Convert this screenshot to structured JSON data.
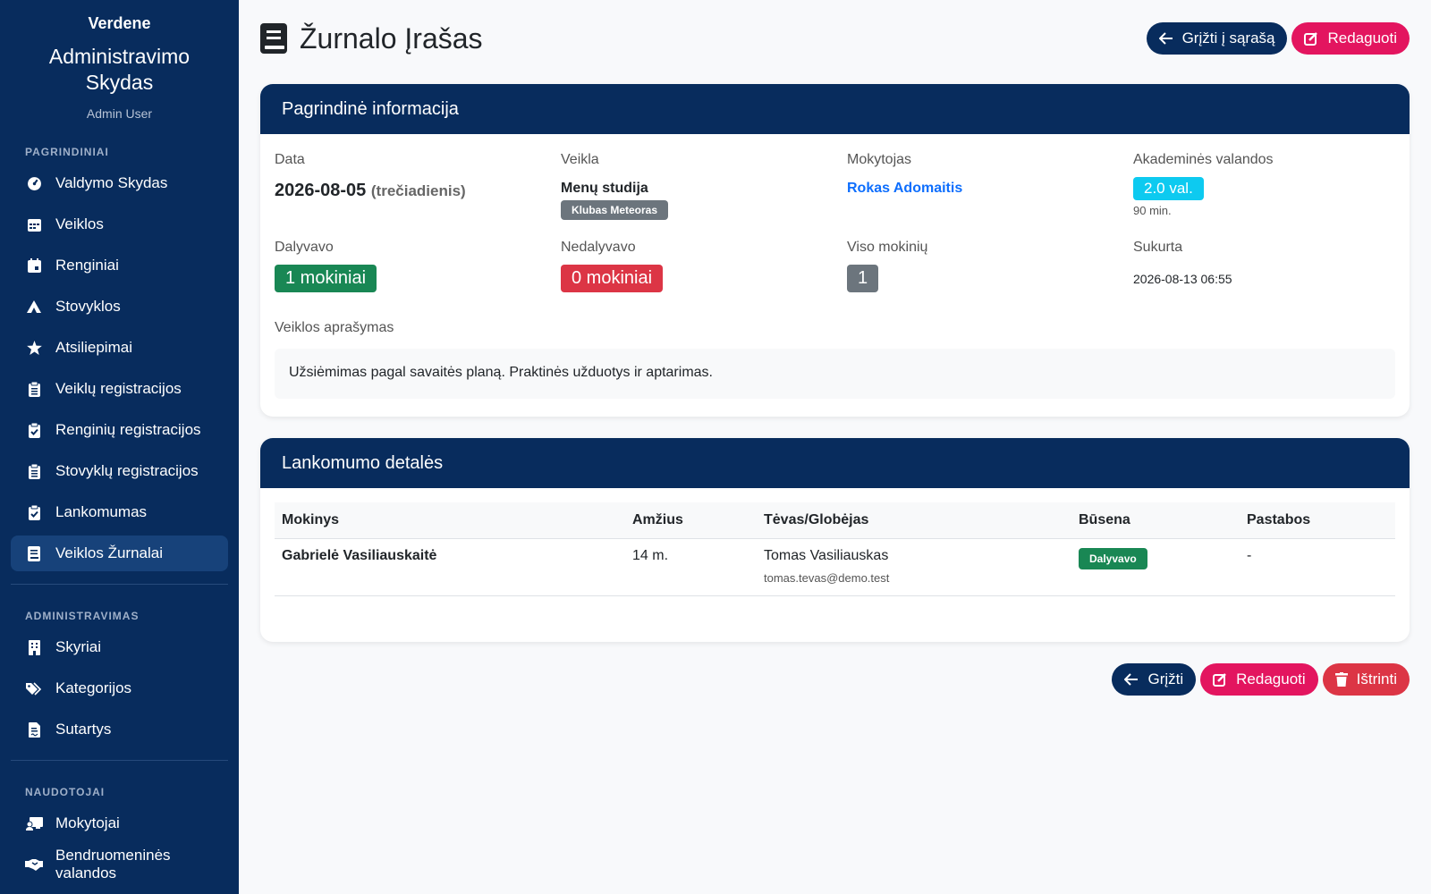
{
  "sidebar": {
    "brand": "Verdene",
    "title": "Administravimo Skydas",
    "user": "Admin User",
    "sections": [
      {
        "title": "PAGRINDINIAI",
        "items": [
          {
            "label": "Valdymo Skydas",
            "icon": "dashboard-icon"
          },
          {
            "label": "Veiklos",
            "icon": "calendar-icon"
          },
          {
            "label": "Renginiai",
            "icon": "calendar-event-icon"
          },
          {
            "label": "Stovyklos",
            "icon": "campground-icon"
          },
          {
            "label": "Atsiliepimai",
            "icon": "star-icon"
          },
          {
            "label": "Veiklų registracijos",
            "icon": "clipboard-list-icon"
          },
          {
            "label": "Renginių registracijos",
            "icon": "clipboard-check-icon"
          },
          {
            "label": "Stovyklų registracijos",
            "icon": "clipboard-list-icon"
          },
          {
            "label": "Lankomumas",
            "icon": "clipboard-check-icon"
          },
          {
            "label": "Veiklos Žurnalai",
            "icon": "book-icon",
            "active": true
          }
        ]
      },
      {
        "title": "ADMINISTRAVIMAS",
        "items": [
          {
            "label": "Skyriai",
            "icon": "building-icon"
          },
          {
            "label": "Kategorijos",
            "icon": "tags-icon"
          },
          {
            "label": "Sutartys",
            "icon": "contract-icon"
          }
        ]
      },
      {
        "title": "NAUDOTOJAI",
        "items": [
          {
            "label": "Mokytojai",
            "icon": "teacher-icon"
          },
          {
            "label": "Bendruomeninės valandos",
            "icon": "handshake-icon"
          }
        ]
      }
    ]
  },
  "header": {
    "title": "Žurnalo Įrašas",
    "back_label": "Grįžti į sąrašą",
    "edit_label": "Redaguoti"
  },
  "info": {
    "header": "Pagrindinė informacija",
    "date_label": "Data",
    "date_value": "2026-08-05",
    "weekday": "(trečiadienis)",
    "activity_label": "Veikla",
    "activity_value": "Menų studija",
    "activity_badge": "Klubas Meteoras",
    "teacher_label": "Mokytojas",
    "teacher_value": "Rokas Adomaitis",
    "hours_label": "Akademinės valandos",
    "hours_value": "2.0 val.",
    "minutes": "90 min.",
    "attended_label": "Dalyvavo",
    "attended_value": "1 mokiniai",
    "absent_label": "Nedalyvavo",
    "absent_value": "0 mokiniai",
    "total_label": "Viso mokinių",
    "total_value": "1",
    "created_label": "Sukurta",
    "created_value": "2026-08-13 06:55",
    "description_label": "Veiklos aprašymas",
    "description": "Užsiėmimas pagal savaitės planą. Praktinės užduotys ir aptarimas."
  },
  "attendance": {
    "header": "Lankomumo detalės",
    "columns": [
      "Mokinys",
      "Amžius",
      "Tėvas/Globėjas",
      "Būsena",
      "Pastabos"
    ],
    "rows": [
      {
        "student": "Gabrielė Vasiliauskaitė",
        "age": "14 m.",
        "parent": "Tomas Vasiliauskas",
        "email": "tomas.tevas@demo.test",
        "status": "Dalyvavo",
        "notes": "-"
      }
    ]
  },
  "footer_actions": {
    "back_label": "Grįžti",
    "edit_label": "Redaguoti",
    "delete_label": "Ištrinti"
  },
  "colors": {
    "navy": "#082c5d",
    "pink": "#e3155f",
    "red": "#dc3545",
    "green": "#198754",
    "cyan": "#0dcaf0",
    "gray": "#6c757d"
  }
}
